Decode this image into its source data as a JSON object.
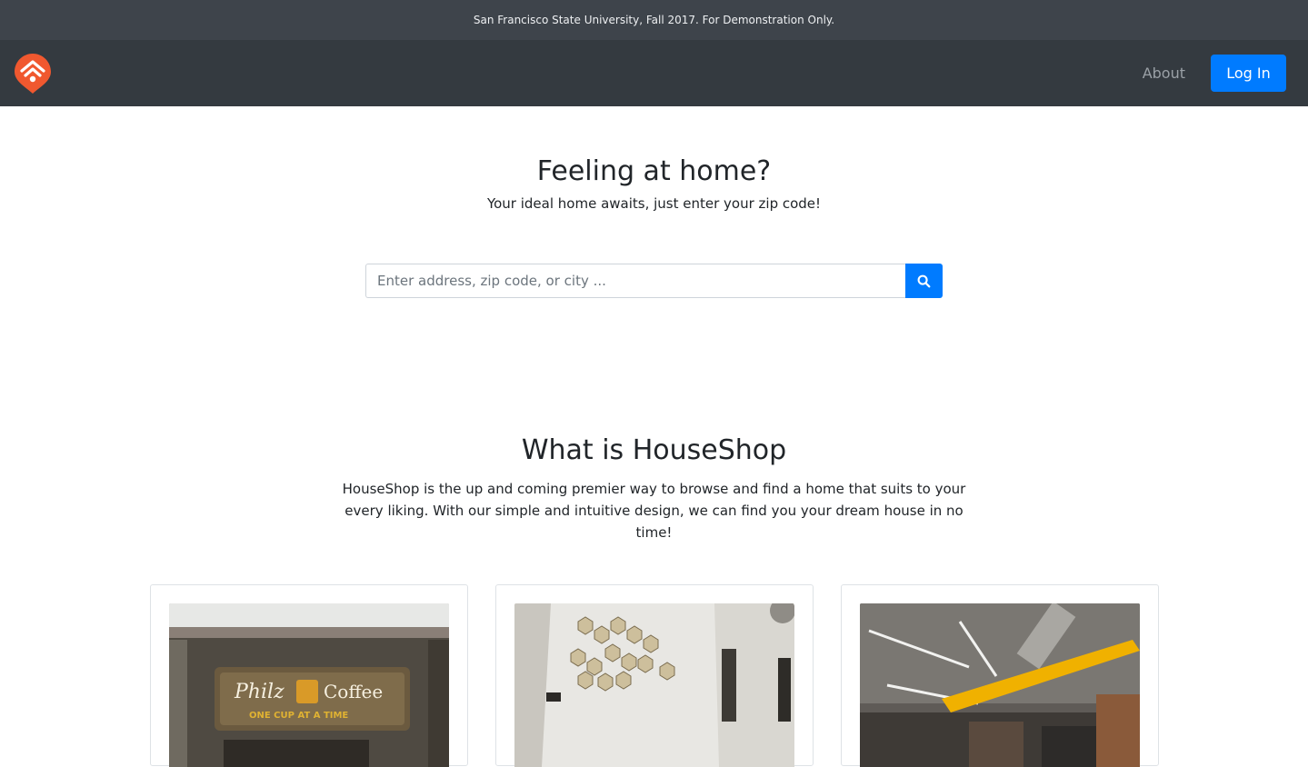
{
  "banner": {
    "text": "San Francisco State University, Fall 2017. For Demonstration Only."
  },
  "navbar": {
    "logo_icon": "houseshop-logo-icon",
    "about_label": "About",
    "login_label": "Log In",
    "accent_color": "#007bff",
    "logo_color": "#f0582f"
  },
  "hero": {
    "title": "Feeling at home?",
    "subtitle": "Your ideal home awaits, just enter your zip code!",
    "search": {
      "placeholder": "Enter address, zip code, or city ...",
      "value": "",
      "button_icon": "search-icon"
    }
  },
  "about": {
    "title": "What is HouseShop",
    "text": "HouseShop is the up and coming premier way to browse and find a home that suits to your every liking. With our simple and intuitive design, we can find you your dream house in no time!"
  },
  "cards": [
    {
      "image_sign_text_1": "Philz",
      "image_sign_text_2": "Coffee",
      "image_sign_text_3": "ONE CUP AT A TIME"
    },
    {},
    {}
  ]
}
